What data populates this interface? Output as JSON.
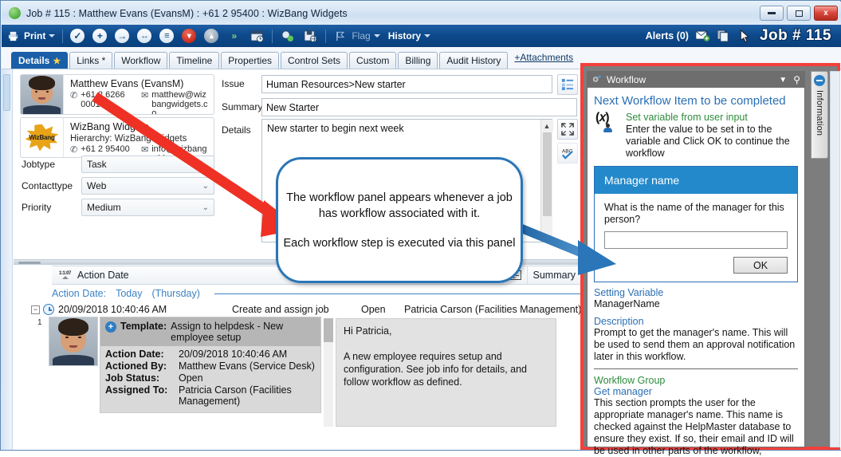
{
  "window": {
    "title": "Job # 115 : Matthew Evans (EvansM) : +61 2 95400 : WizBang Widgets",
    "status_dot_color": "#4fae3d",
    "minimize_label": "Minimize",
    "maximize_label": "Maximize",
    "close_label": "x"
  },
  "toolbar": {
    "print_label": "Print",
    "flag_label": "Flag",
    "history_label": "History",
    "alerts_label": "Alerts (0)",
    "job_number": "Job # 115",
    "icons": [
      "print-icon",
      "tick-icon",
      "plus-icon",
      "arrow-right-icon",
      "arrow-both-icon",
      "list-icon",
      "chevron-down-circle-icon",
      "chevron-up-circle-icon",
      "double-chevron-icon",
      "calendar-clock-icon",
      "find-person-icon",
      "save-web-icon",
      "flag-icon",
      "history-icon",
      "new-email-icon",
      "copy-icon",
      "pointer-icon"
    ]
  },
  "tabs": {
    "items": [
      {
        "label": "Details",
        "starred": true,
        "active": true
      },
      {
        "label": "Links *",
        "starred": false,
        "active": false
      },
      {
        "label": "Workflow",
        "starred": false,
        "active": false
      },
      {
        "label": "Timeline",
        "starred": false,
        "active": false
      },
      {
        "label": "Properties",
        "starred": false,
        "active": false
      },
      {
        "label": "Control Sets",
        "starred": false,
        "active": false
      },
      {
        "label": "Custom",
        "starred": false,
        "active": false
      },
      {
        "label": "Billing",
        "starred": false,
        "active": false
      },
      {
        "label": "Audit History",
        "starred": false,
        "active": false
      }
    ],
    "attachments_link": "+Attachments"
  },
  "details": {
    "contact_card": {
      "name": "Matthew Evans (EvansM)",
      "phone": "+61 2 6266 0001",
      "email": "matthew@wizbangwidgets.co"
    },
    "company_card": {
      "name": "WizBang Widgets",
      "hierarchy": "Hierarchy: WizBang Widgets",
      "phone": "+61 2 95400",
      "email": "info@wizbangwidgets.com",
      "logo_text": "WizBang"
    },
    "fields": [
      {
        "label": "Jobtype",
        "value": "Task"
      },
      {
        "label": "Contacttype",
        "value": "Web"
      },
      {
        "label": "Priority",
        "value": "Medium"
      }
    ],
    "issue_label": "Issue",
    "issue_value": "Human Resources>New starter",
    "summary_label": "Summary",
    "summary_value": "New Starter",
    "details_label": "Details",
    "details_value": "New starter to begin next week",
    "side_buttons": [
      "issue-tree-icon",
      "expand-icon",
      "spellcheck-icon"
    ]
  },
  "actions": {
    "columns": [
      "Action Date",
      "Summary"
    ],
    "attachment_col_icon": "paperclip-icon",
    "note_col_icon": "note-icon",
    "group_label": "Action Date:",
    "group_value": "Today",
    "group_day": "(Thursday)",
    "row": {
      "number": "1",
      "timestamp": "20/09/2018 10:40:46 AM",
      "summary": "Create and assign job",
      "status": "Open",
      "assignee": "Patricia Carson (Facilities Management)",
      "template_label": "Template:",
      "template_value": "Assign to helpdesk - New employee setup",
      "fields": [
        {
          "key": "Action Date:",
          "value": "20/09/2018 10:40:46 AM"
        },
        {
          "key": "Actioned By:",
          "value": "Matthew Evans (Service Desk)"
        },
        {
          "key": "Job Status:",
          "value": "Open"
        },
        {
          "key": "Assigned To:",
          "value": "Patricia Carson (Facilities Management)"
        }
      ],
      "note_greeting": "Hi Patricia,",
      "note_body": "A new employee requires setup and configuration.  See job info for details, and follow workflow as defined."
    }
  },
  "workflow_panel": {
    "title": "Workflow",
    "title_icon": "workflow-gear-icon",
    "collapse_icon": "chevron-down-icon",
    "pin_icon": "pin-icon",
    "heading": "Next Workflow Item to be completed",
    "step_icon": "set-variable-icon",
    "step_title": "Set variable from user input",
    "step_desc": "Enter the value to be set in to the variable and Click OK to continue the workflow",
    "dialog": {
      "title": "Manager name",
      "question": "What is the name of the manager for this person?",
      "input_value": "",
      "input_placeholder": "",
      "ok_label": "OK"
    },
    "setting_variable_label": "Setting Variable",
    "setting_variable_value": "ManagerName",
    "description_label": "Description",
    "description_value": "Prompt to get the manager's name. This will be used to send them an approval notification later in this workflow.",
    "workflow_group_label": "Workflow Group",
    "workflow_group_name": "Get manager",
    "workflow_group_desc": "This section prompts the user for the appropriate manager's name. This name is checked against the HelpMaster database to ensure they exist. If so, their email and ID will be used in other parts of the workflow,",
    "highlight_color": "#f4403a",
    "accent_color": "#2389cb"
  },
  "information_tab": {
    "label": "Information",
    "icon": "minus-circle-icon"
  },
  "annotation": {
    "line1": "The workflow panel appears whenever a job has workflow associated with it.",
    "line2": "Each workflow step is executed via this panel",
    "arrow_red_color": "#ee3124",
    "arrow_blue_color": "#2a76b8",
    "border_color": "#2a76b8"
  }
}
